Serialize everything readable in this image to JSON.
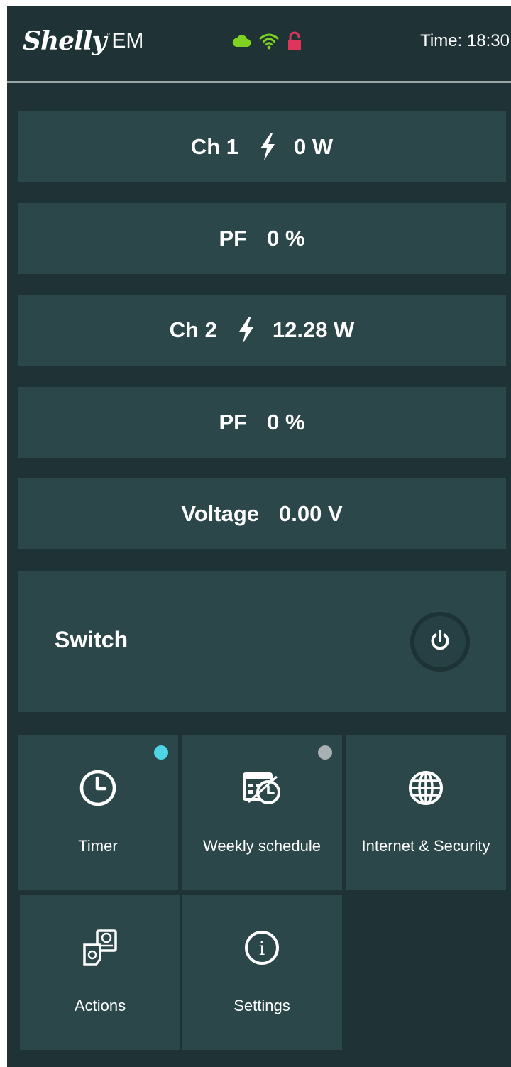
{
  "header": {
    "logo_script": "Shelly",
    "logo_model": "EM",
    "time": "Time: 18:30"
  },
  "status": {
    "cloud_icon": "cloud-icon",
    "wifi_icon": "wifi-icon",
    "lock_icon": "unlocked-icon",
    "cloud_color": "#7ed321",
    "wifi_color": "#7ed321",
    "lock_color": "#e0355b"
  },
  "rows": [
    {
      "label": "Ch 1",
      "icon": "bolt-icon",
      "value": "0 W"
    },
    {
      "label": "PF",
      "value": "0 %"
    },
    {
      "label": "Ch 2",
      "icon": "bolt-icon",
      "value": "12.28 W"
    },
    {
      "label": "PF",
      "value": "0 %"
    },
    {
      "label": "Voltage",
      "value": "0.00 V"
    }
  ],
  "switch": {
    "label": "Switch",
    "icon": "power-icon"
  },
  "tiles": [
    {
      "label": "Timer",
      "icon": "clock-icon",
      "indicator_color": "#4fd3e6"
    },
    {
      "label": "Weekly schedule",
      "icon": "calendar-icon",
      "indicator_color": "#a9b0b1"
    },
    {
      "label": "Internet & Security",
      "icon": "globe-icon"
    },
    {
      "label": "Actions",
      "icon": "actions-icon"
    },
    {
      "label": "Settings",
      "icon": "info-icon"
    }
  ],
  "colors": {
    "background": "#1f3336",
    "panel": "#2b4749",
    "text": "#ffffff"
  }
}
